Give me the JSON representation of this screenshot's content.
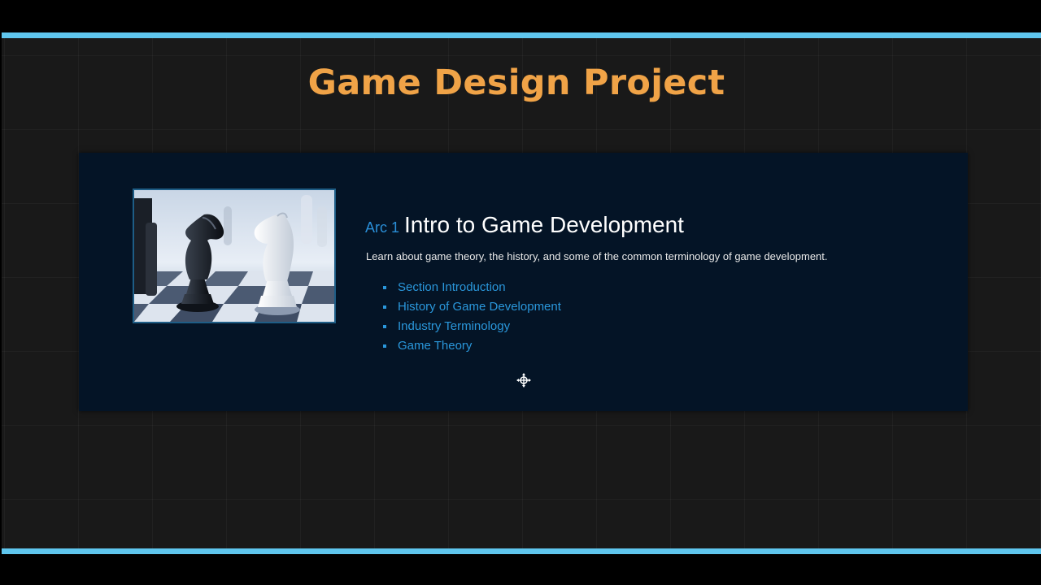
{
  "slide": {
    "title": "Game Design Project"
  },
  "arc": {
    "label": "Arc 1",
    "title": "Intro to Game Development",
    "description": "Learn about game theory, the history, and some of the common terminology of game development.",
    "image": "chess-knights-photo",
    "lessons": [
      {
        "label": "Section Introduction"
      },
      {
        "label": "History of Game Development"
      },
      {
        "label": "Industry Terminology"
      },
      {
        "label": "Game Theory"
      }
    ]
  },
  "cursor": {
    "icon": "move-cursor-icon"
  },
  "colors": {
    "accent_bar": "#5fc6ee",
    "title": "#f0a347",
    "card_bg": "#041426",
    "link": "#2a97db"
  }
}
